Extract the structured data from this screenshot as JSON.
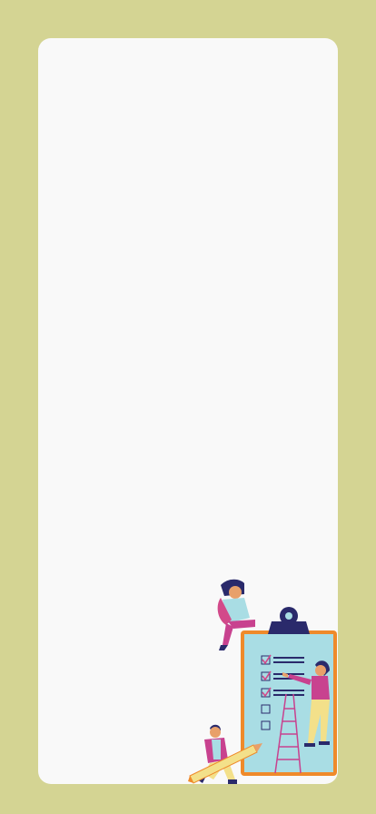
{
  "background_color": "#d4d493",
  "card_color": "#f9f9f9",
  "illustration": {
    "name": "todo-checklist-illustration",
    "checklist_items": [
      {
        "checked": true
      },
      {
        "checked": true
      },
      {
        "checked": true
      },
      {
        "checked": false
      },
      {
        "checked": false
      }
    ],
    "colors": {
      "clipboard_frame": "#ef8a2a",
      "clipboard_paper": "#a9dde4",
      "clip": "#2a2a6b",
      "ink": "#2a2a6b",
      "check": "#d24a8a",
      "person_pink": "#c8428f",
      "person_yellow": "#f3e08a",
      "skin": "#e8a06a"
    }
  }
}
